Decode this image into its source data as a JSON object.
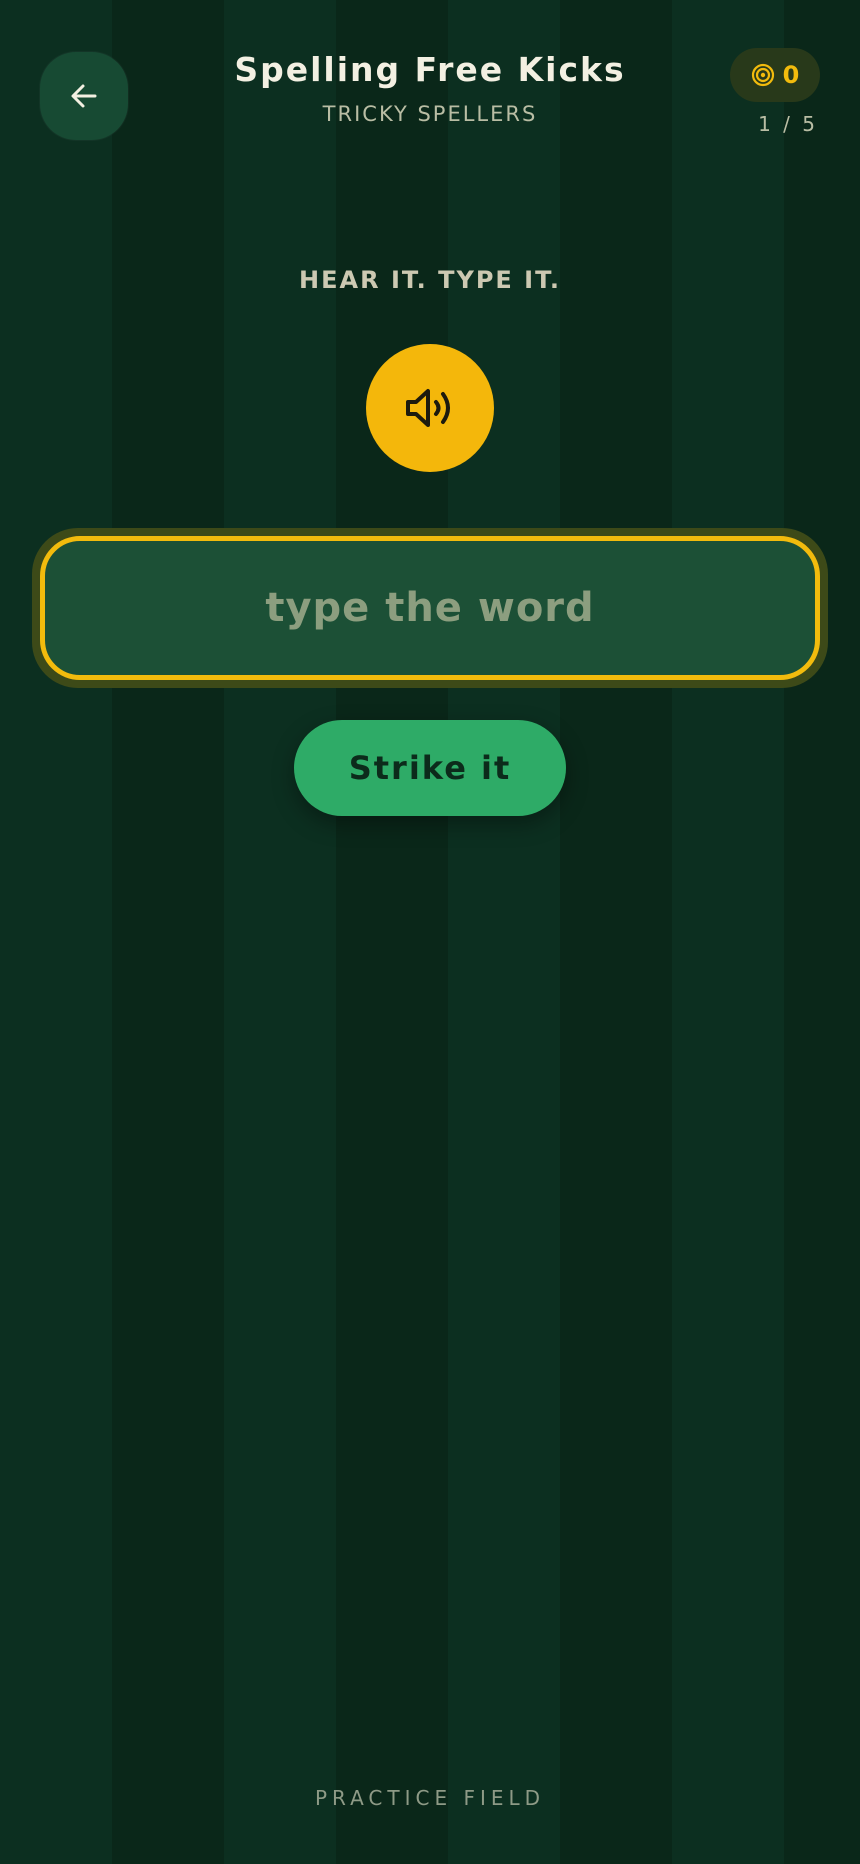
{
  "header": {
    "back_icon": "arrow-left-icon",
    "title": "Spelling Free Kicks",
    "subtitle": "TRICKY SPELLERS",
    "score_icon": "target-icon",
    "score": "0",
    "progress": "1 / 5"
  },
  "main": {
    "instruction": "HEAR IT. TYPE IT.",
    "play_icon": "speaker-icon",
    "input": {
      "placeholder": "type the word",
      "value": ""
    },
    "submit_label": "Strike it"
  },
  "footer": {
    "label": "PRACTICE FIELD"
  },
  "colors": {
    "background_dark": "#0a2719",
    "background_light": "#0c2f20",
    "accent_yellow": "#f2bb0d",
    "button_green": "#2eab67",
    "input_fill": "#1c5036",
    "title_text": "#f3f0e2"
  }
}
